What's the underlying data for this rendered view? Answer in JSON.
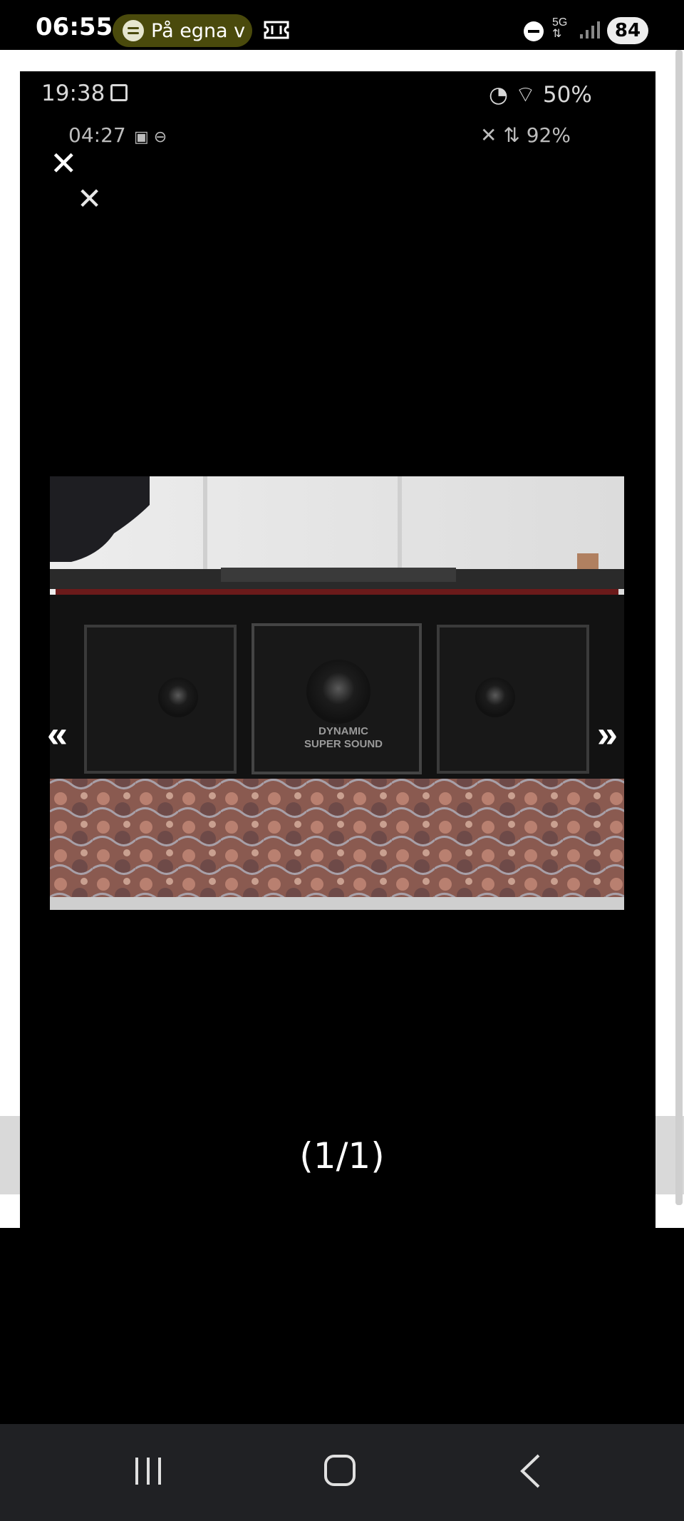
{
  "status_bar": {
    "time": "06:55",
    "media_pill_text": "På egna v",
    "battery": "84"
  },
  "screenshot_status_1": {
    "time": "19:38",
    "right": "50%"
  },
  "screenshot_status_2": {
    "time": "04:27",
    "right": "92%"
  },
  "lightbox": {
    "prev_label": "«",
    "next_label": "»",
    "counter": "(1/1)",
    "close_glyph": "✕"
  },
  "photo": {
    "speaker_text_1": "DYNAMIC",
    "speaker_text_2": "SUPER SOUND"
  },
  "colors": {
    "pill_bg": "#4a4a0c",
    "navbar_bg": "#202124"
  }
}
